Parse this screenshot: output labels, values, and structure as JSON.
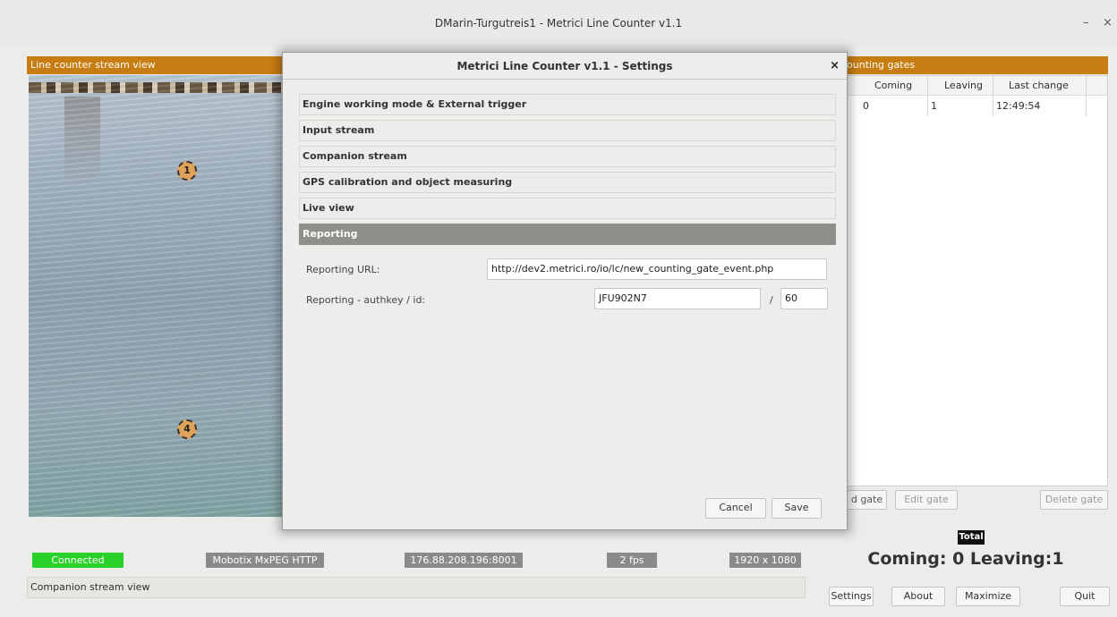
{
  "window": {
    "title": "DMarin-Turgutreis1 - Metrici Line Counter v1.1",
    "minimize_glyph": "–",
    "close_glyph": "×"
  },
  "stream_panel": {
    "header": "Line counter stream view",
    "markers": [
      "1",
      "4"
    ]
  },
  "status": {
    "connection": "Connected",
    "source": "Mobotix MxPEG HTTP",
    "address": "176.88.208.196:8001",
    "fps": "2 fps",
    "resolution": "1920 x 1080",
    "colors": {
      "connected": "#2ad12a",
      "header": "#c77d12"
    }
  },
  "companion": {
    "label": "Companion stream view"
  },
  "gates_panel": {
    "header": "counting gates",
    "columns": [
      "Coming",
      "Leaving",
      "Last change"
    ],
    "rows": [
      {
        "coming": "0",
        "leaving": "1",
        "last_change": "12:49:54"
      }
    ],
    "buttons": {
      "add": "d gate",
      "edit": "Edit gate",
      "delete": "Delete gate"
    }
  },
  "totals": {
    "badge": "Total",
    "text": "Coming: 0  Leaving:1"
  },
  "bottom_buttons": {
    "settings": "Settings",
    "about": "About",
    "maximize": "Maximize",
    "quit": "Quit"
  },
  "dialog": {
    "title": "Metrici Line Counter v1.1 - Settings",
    "close_glyph": "×",
    "sections": [
      "Engine working mode & External trigger",
      "Input stream",
      "Companion stream",
      "GPS calibration and object measuring",
      "Live view",
      "Reporting"
    ],
    "active_section": "Reporting",
    "reporting": {
      "url_label": "Reporting URL:",
      "url_value": "http://dev2.metrici.ro/io/lc/new_counting_gate_event.php",
      "auth_label": "Reporting - authkey / id:",
      "authkey_value": "JFU902N7",
      "separator": "/",
      "id_value": "60"
    },
    "buttons": {
      "cancel": "Cancel",
      "save": "Save"
    }
  }
}
